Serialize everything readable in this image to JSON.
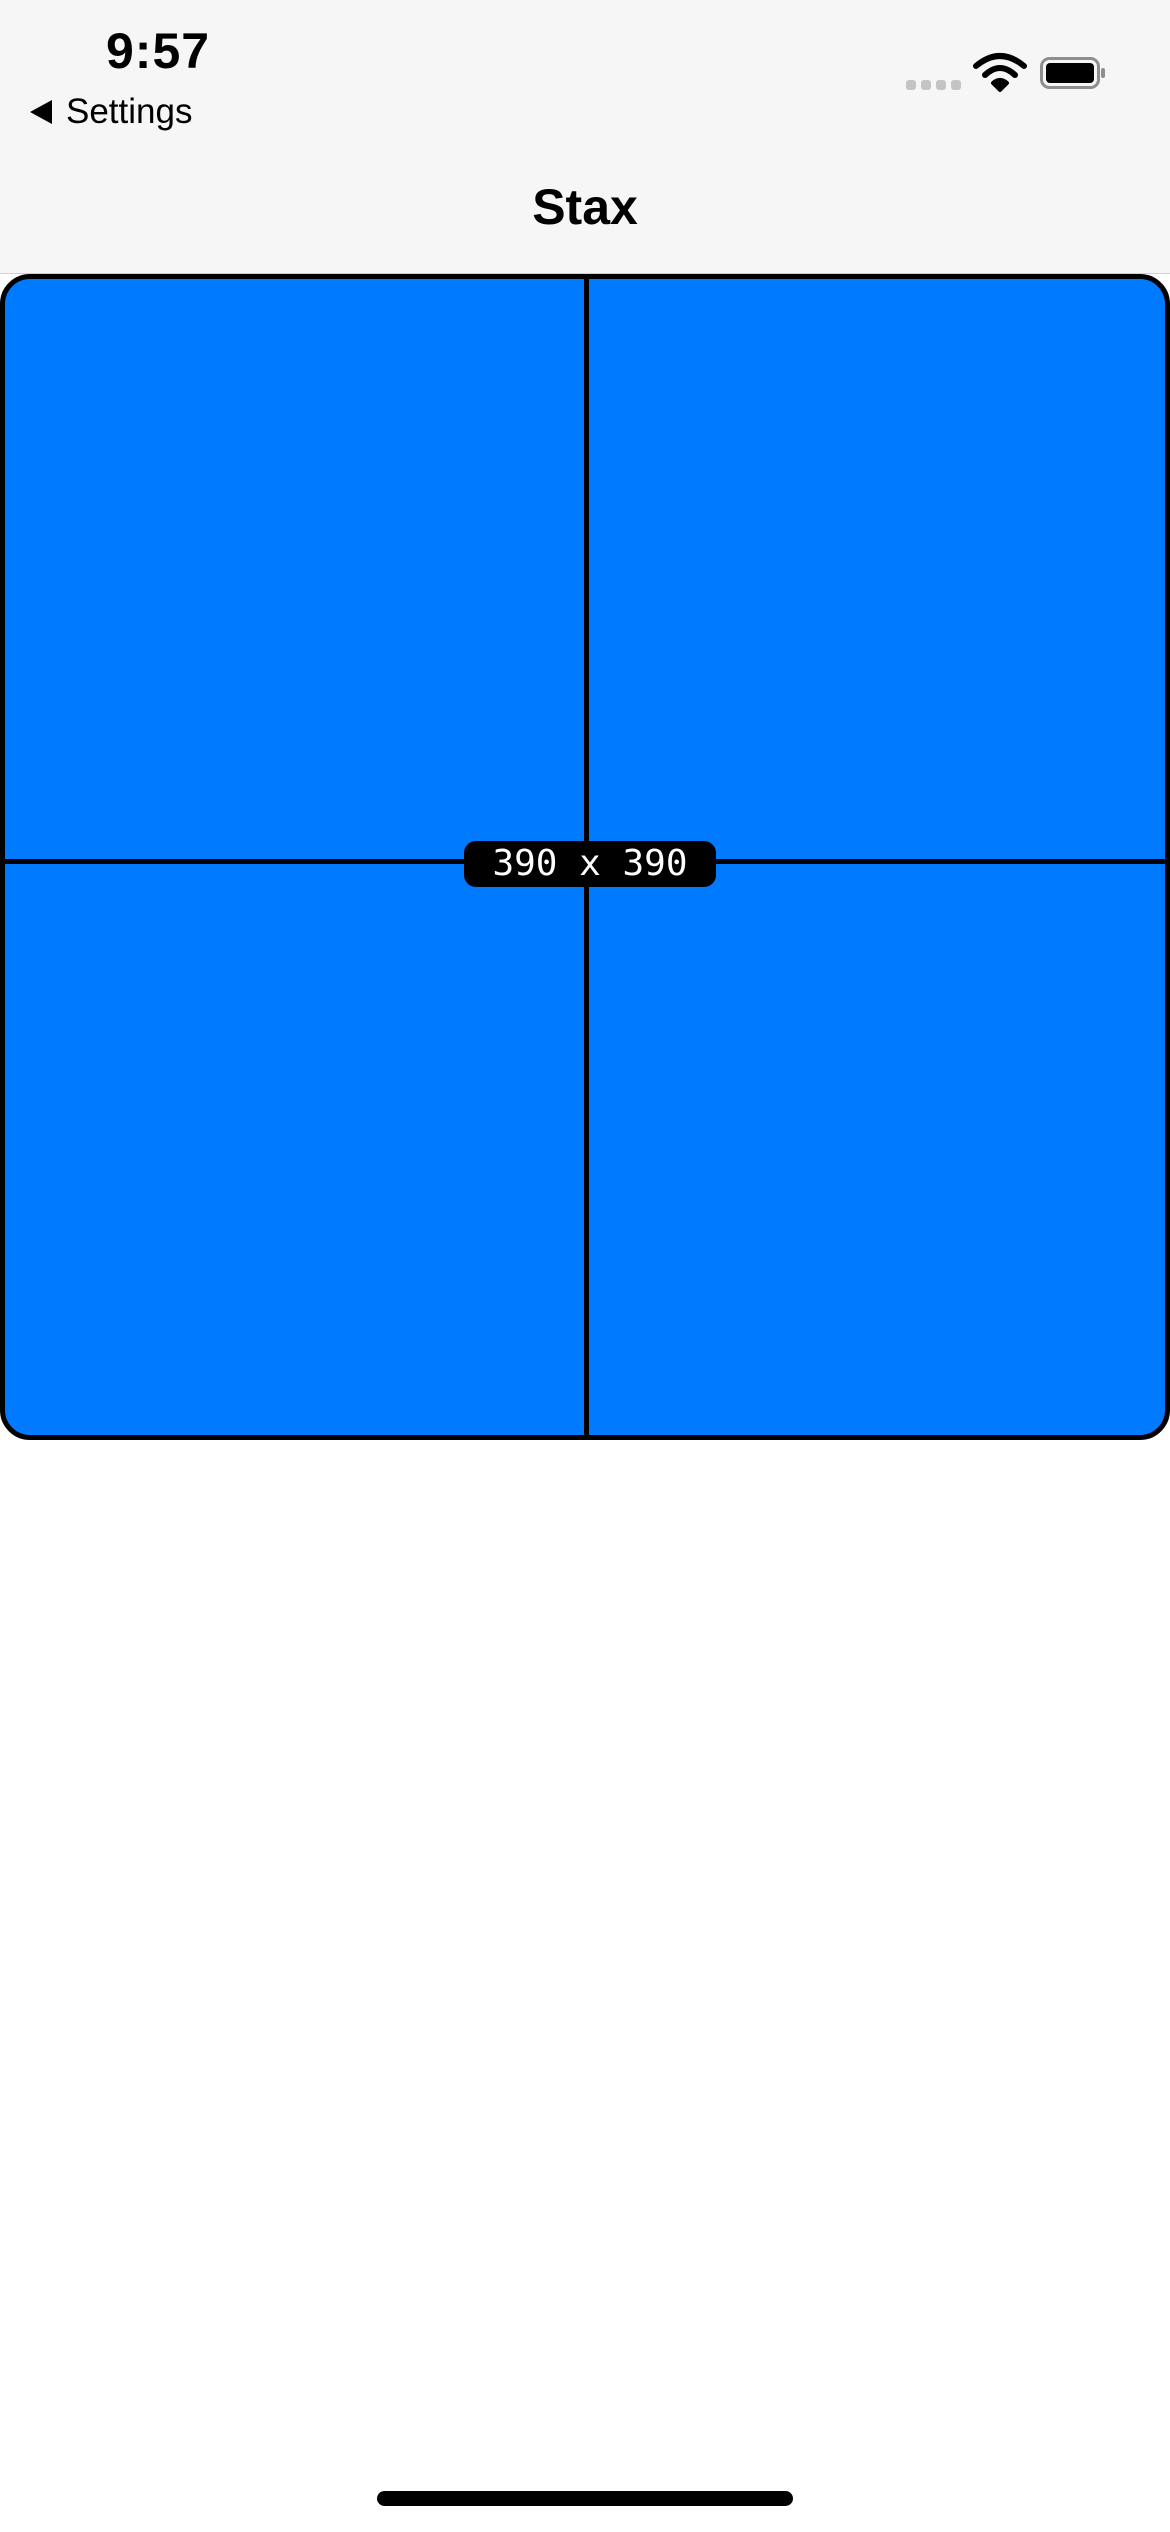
{
  "status_bar": {
    "time": "9:57",
    "icons": [
      "cellular-signal-icon",
      "wifi-icon",
      "battery-icon"
    ]
  },
  "nav": {
    "back_label": "Settings",
    "title": "Stax"
  },
  "canvas": {
    "dimension_label": "390 x 390",
    "fill_color": "#007aff",
    "border_color": "#000000"
  }
}
